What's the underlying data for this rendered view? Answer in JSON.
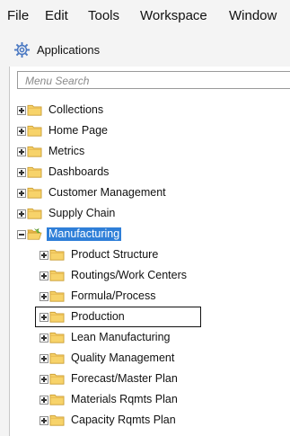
{
  "menubar": {
    "items": [
      "File",
      "Edit",
      "Tools",
      "Workspace",
      "Window"
    ]
  },
  "applications": {
    "label": "Applications",
    "icon": "gear-icon"
  },
  "search": {
    "placeholder": "Menu Search"
  },
  "tree": {
    "top_items": [
      {
        "label": "Collections",
        "state": "collapsed"
      },
      {
        "label": "Home Page",
        "state": "collapsed"
      },
      {
        "label": "Metrics",
        "state": "collapsed"
      },
      {
        "label": "Dashboards",
        "state": "collapsed"
      },
      {
        "label": "Customer Management",
        "state": "collapsed"
      },
      {
        "label": "Supply Chain",
        "state": "collapsed"
      },
      {
        "label": "Manufacturing",
        "state": "expanded",
        "selected": true
      }
    ],
    "manufacturing_children": [
      {
        "label": "Product Structure",
        "state": "collapsed"
      },
      {
        "label": "Routings/Work Centers",
        "state": "collapsed"
      },
      {
        "label": "Formula/Process",
        "state": "collapsed"
      },
      {
        "label": "Production",
        "state": "collapsed",
        "outlined": true
      },
      {
        "label": "Lean Manufacturing",
        "state": "collapsed"
      },
      {
        "label": "Quality Management",
        "state": "collapsed"
      },
      {
        "label": "Forecast/Master Plan",
        "state": "collapsed"
      },
      {
        "label": "Materials Rqmts Plan",
        "state": "collapsed"
      },
      {
        "label": "Capacity Rqmts Plan",
        "state": "collapsed"
      }
    ]
  },
  "colors": {
    "selection": "#2f7fd8",
    "folder_fill": "#f7d36a",
    "folder_edge": "#c89a2e"
  }
}
